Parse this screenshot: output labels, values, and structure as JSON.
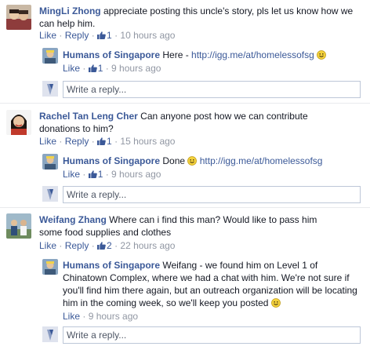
{
  "threads": [
    {
      "comment": {
        "author": "MingLi Zhong",
        "text": "appreciate posting this uncle's story, pls let us know how we can help him.",
        "like": "Like",
        "reply": "Reply",
        "likes": "1",
        "time": "10 hours ago"
      },
      "reply": {
        "author": "Humans of Singapore",
        "text_before": "Here -",
        "link": "http://igg.me/at/homelessofsg",
        "like": "Like",
        "likes": "1",
        "time": "9 hours ago"
      },
      "reply_placeholder": "Write a reply..."
    },
    {
      "comment": {
        "author": "Rachel Tan Leng Cher",
        "text": "Can anyone post how we can contribute donations to him?",
        "like": "Like",
        "reply": "Reply",
        "likes": "1",
        "time": "15 hours ago"
      },
      "reply": {
        "author": "Humans of Singapore",
        "text_before": "Done",
        "link": "http://igg.me/at/homelessofsg",
        "like": "Like",
        "likes": "1",
        "time": "9 hours ago"
      },
      "reply_placeholder": "Write a reply..."
    },
    {
      "comment": {
        "author": "Weifang Zhang",
        "text": "Where can i find this man? Would like to pass him some food supplies and clothes",
        "like": "Like",
        "reply": "Reply",
        "likes": "2",
        "time": "22 hours ago"
      },
      "reply": {
        "author": "Humans of Singapore",
        "text": "Weifang - we found him on Level 1 of Chinatown Complex, where we had a chat with him. We're not sure if you'll find him there again, but an outreach organization will be locating him in the coming week, so we'll keep you posted",
        "like": "Like",
        "time": "9 hours ago"
      },
      "reply_placeholder": "Write a reply..."
    }
  ],
  "colors": {
    "link": "#3b5998",
    "meta_gray": "#9197a3",
    "separator": "#e9eaed",
    "input_border": "#bdc7d8"
  },
  "icons": [
    "like-thumb-icon",
    "smiley-icon",
    "hos-avatar",
    "user-avatar"
  ]
}
